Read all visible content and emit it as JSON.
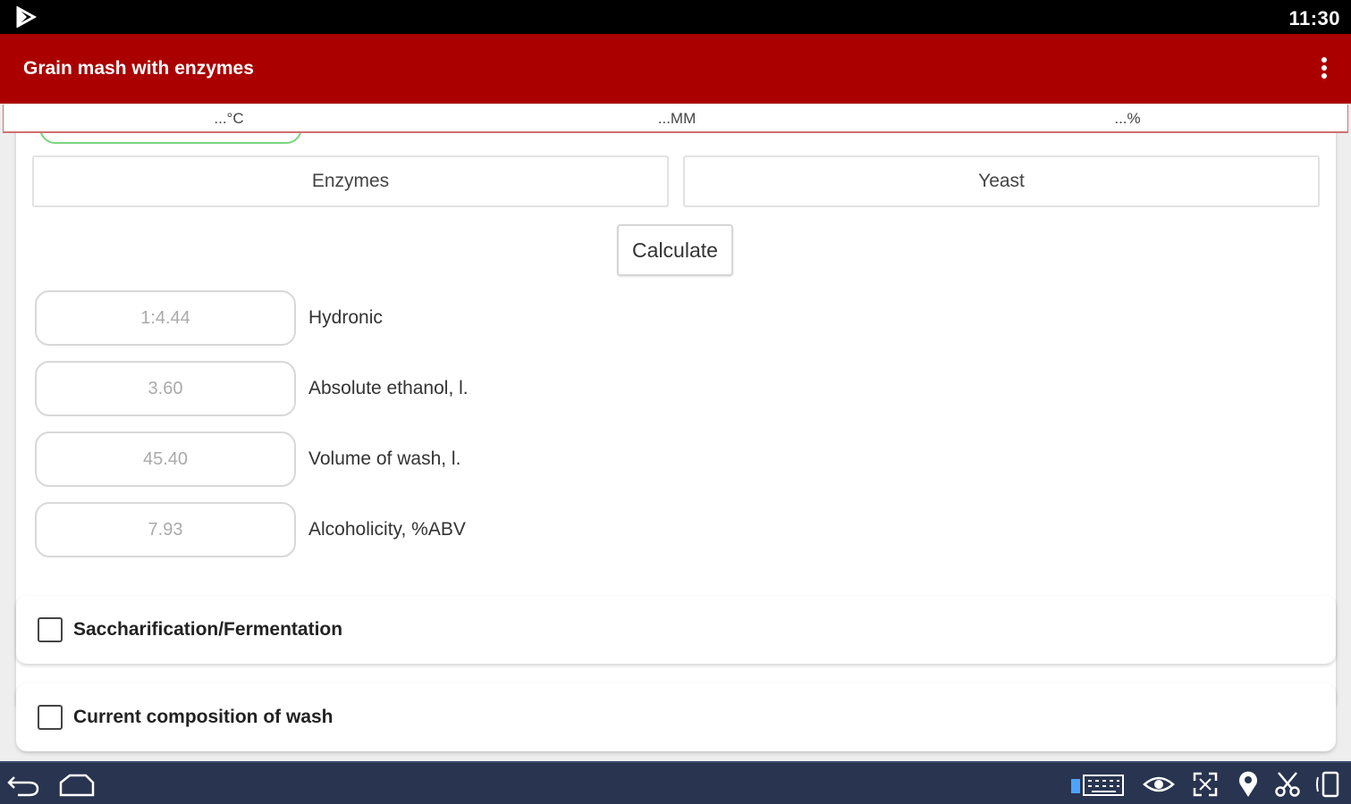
{
  "status_bar": {
    "time": "11:30"
  },
  "app_bar": {
    "title": "Grain mash with enzymes"
  },
  "units": [
    "...°C",
    "...MM",
    "...%"
  ],
  "buttons": {
    "enzymes": "Enzymes",
    "yeast": "Yeast",
    "calculate": "Calculate"
  },
  "results": [
    {
      "value": "1:4.44",
      "label": "Hydronic"
    },
    {
      "value": "3.60",
      "label": "Absolute ethanol, l."
    },
    {
      "value": "45.40",
      "label": "Volume of wash, l."
    },
    {
      "value": "7.93",
      "label": "Alcoholicity, %ABV"
    }
  ],
  "sections": [
    {
      "label": "Saccharification/Fermentation",
      "checked": false
    },
    {
      "label": "Current composition of wash",
      "checked": false
    }
  ],
  "icons": {
    "status_left": "play-store-icon",
    "menu": "more-vert-icon",
    "nav": [
      "back-icon",
      "home-icon",
      "keyboard-icon",
      "eye-icon",
      "fullscreen-icon",
      "location-icon",
      "scissors-icon",
      "rotate-icon"
    ]
  },
  "colors": {
    "app_bar": "#aa0000",
    "nav_bar": "#283450",
    "input_highlight": "#7cd47c"
  }
}
